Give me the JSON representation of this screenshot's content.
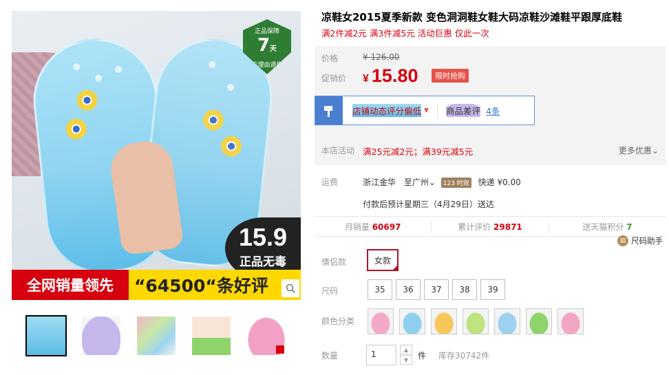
{
  "gallery": {
    "guarantee_badge": {
      "line1": "正品保障",
      "num": "7",
      "unit": "天",
      "line2": "无理由退换"
    },
    "price_tag": {
      "value": "15.9",
      "text": "正品无毒"
    },
    "banner": {
      "left": "全网销量领先",
      "right": "“64500“条好评"
    },
    "thumbs": [
      {
        "name": "thumb-1",
        "active": true
      },
      {
        "name": "thumb-2"
      },
      {
        "name": "thumb-3"
      },
      {
        "name": "thumb-4"
      },
      {
        "name": "thumb-5"
      }
    ]
  },
  "product": {
    "title": "凉鞋女2015夏季新款 变色洞洞鞋女鞋大码凉鞋沙滩鞋平跟厚底鞋",
    "promo_line": "满2件减2元 满3件减5元 活动巨惠 仅此一次"
  },
  "price": {
    "orig_label": "价格",
    "orig_value": "¥ 126.00",
    "promo_label": "促销价",
    "currency": "¥",
    "promo_value": "15.80",
    "flash_tag": "限时抢购"
  },
  "rating": {
    "text": "店铺动态评分偏低",
    "bad_label": "商品差评",
    "bad_count": "4条"
  },
  "store_promo": {
    "label": "本店活动",
    "text": "满25元减2元；满39元减5元",
    "more": "更多优惠"
  },
  "shipping": {
    "label": "运费",
    "from": "浙江金华",
    "to": "至广州",
    "days_badge": "123 时效",
    "fee": "快递 ¥0.00",
    "delivery": "付款后预计星期三（4月29日）送达"
  },
  "stats": {
    "monthly_label": "月销量",
    "monthly": "60697",
    "reviews_label": "累计评价",
    "reviews": "29871",
    "points_label": "送天猫积分",
    "points": "7"
  },
  "size_helper": "尺码助手",
  "options": {
    "couple_label": "情侣款",
    "couple_value": "女款",
    "size_label": "尺码",
    "sizes": [
      "35",
      "36",
      "37",
      "38",
      "39"
    ],
    "color_label": "颜色分类",
    "colors": [
      "#f4a9c8",
      "#8fd0f0",
      "#f6c75a",
      "#bfe37f",
      "#9ed0ef",
      "#8fd46a",
      "#f2a6c4"
    ],
    "qty_label": "数量",
    "qty_value": "1",
    "qty_unit": "件",
    "stock": "库存30742件"
  }
}
